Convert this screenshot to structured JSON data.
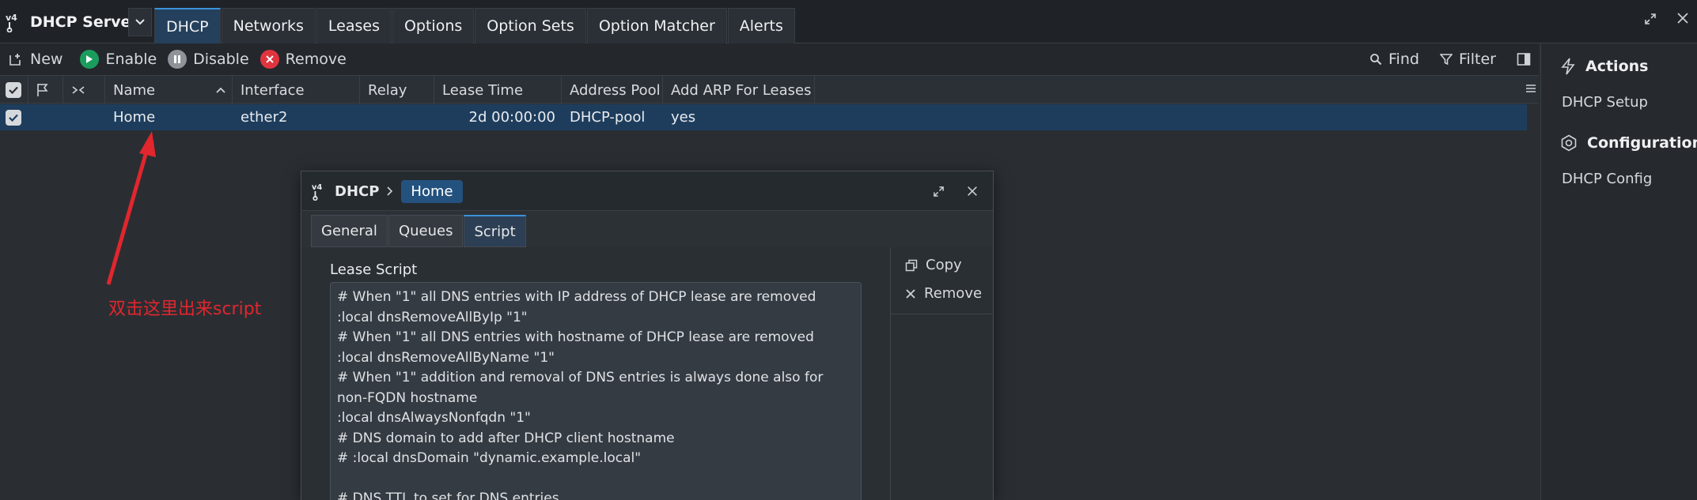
{
  "app": {
    "title": "DHCP Server"
  },
  "tabs": [
    {
      "label": "DHCP",
      "active": true
    },
    {
      "label": "Networks"
    },
    {
      "label": "Leases"
    },
    {
      "label": "Options"
    },
    {
      "label": "Option Sets"
    },
    {
      "label": "Option Matcher"
    },
    {
      "label": "Alerts"
    }
  ],
  "toolbar": {
    "new_label": "New",
    "enable_label": "Enable",
    "disable_label": "Disable",
    "remove_label": "Remove",
    "find_label": "Find",
    "filter_label": "Filter"
  },
  "table": {
    "columns": [
      "Name",
      "Interface",
      "Relay",
      "Lease Time",
      "Address Pool",
      "Add ARP For Leases"
    ],
    "rows": [
      {
        "name": "Home",
        "interface": "ether2",
        "relay": "",
        "lease_time": "2d 00:00:00",
        "address_pool": "DHCP-pool",
        "add_arp": "yes"
      }
    ]
  },
  "sidebar": {
    "actions_heading": "Actions",
    "actions_item": "DHCP Setup",
    "config_heading": "Configuration",
    "config_item": "DHCP Config"
  },
  "annotation": {
    "text": "双击这里出来script",
    "color": "#e1262d"
  },
  "dialog": {
    "title": "DHCP",
    "breadcrumb": "Home",
    "tabs": [
      "General",
      "Queues",
      "Script"
    ],
    "active_tab": "Script",
    "field_label": "Lease Script",
    "script_lines": [
      "# When \"1\" all DNS entries with IP address of DHCP lease are removed",
      ":local dnsRemoveAllByIp \"1\"",
      "# When \"1\" all DNS entries with hostname of DHCP lease are removed",
      ":local dnsRemoveAllByName \"1\"",
      "# When \"1\" addition and removal of DNS entries is always done also for non-FQDN hostname",
      ":local dnsAlwaysNonfqdn \"1\"",
      "# DNS domain to add after DHCP client hostname",
      "# :local dnsDomain \"dynamic.example.local\"",
      "",
      "# DNS TTL to set for DNS entries"
    ],
    "copy_label": "Copy",
    "remove_label": "Remove"
  },
  "colors": {
    "accent": "#3a93d9",
    "selected_row": "#1e3d5d",
    "enable_green": "#1a9d5c",
    "remove_red": "#e0343f"
  }
}
